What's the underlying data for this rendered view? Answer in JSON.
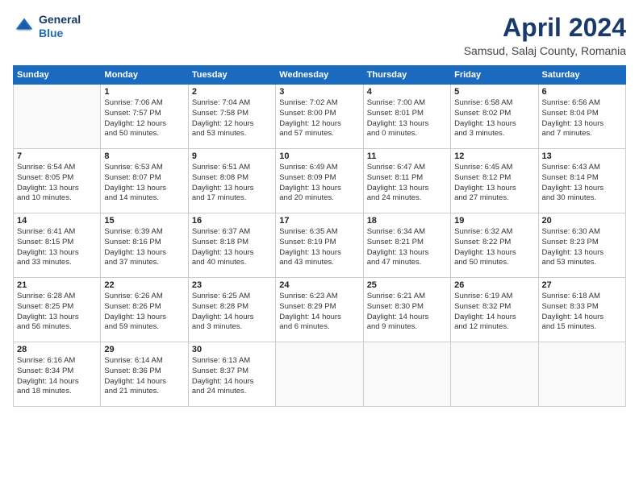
{
  "header": {
    "logo_line1": "General",
    "logo_line2": "Blue",
    "title": "April 2024",
    "subtitle": "Samsud, Salaj County, Romania"
  },
  "days_of_week": [
    "Sunday",
    "Monday",
    "Tuesday",
    "Wednesday",
    "Thursday",
    "Friday",
    "Saturday"
  ],
  "weeks": [
    [
      {
        "day": "",
        "info": ""
      },
      {
        "day": "1",
        "info": "Sunrise: 7:06 AM\nSunset: 7:57 PM\nDaylight: 12 hours\nand 50 minutes."
      },
      {
        "day": "2",
        "info": "Sunrise: 7:04 AM\nSunset: 7:58 PM\nDaylight: 12 hours\nand 53 minutes."
      },
      {
        "day": "3",
        "info": "Sunrise: 7:02 AM\nSunset: 8:00 PM\nDaylight: 12 hours\nand 57 minutes."
      },
      {
        "day": "4",
        "info": "Sunrise: 7:00 AM\nSunset: 8:01 PM\nDaylight: 13 hours\nand 0 minutes."
      },
      {
        "day": "5",
        "info": "Sunrise: 6:58 AM\nSunset: 8:02 PM\nDaylight: 13 hours\nand 3 minutes."
      },
      {
        "day": "6",
        "info": "Sunrise: 6:56 AM\nSunset: 8:04 PM\nDaylight: 13 hours\nand 7 minutes."
      }
    ],
    [
      {
        "day": "7",
        "info": "Sunrise: 6:54 AM\nSunset: 8:05 PM\nDaylight: 13 hours\nand 10 minutes."
      },
      {
        "day": "8",
        "info": "Sunrise: 6:53 AM\nSunset: 8:07 PM\nDaylight: 13 hours\nand 14 minutes."
      },
      {
        "day": "9",
        "info": "Sunrise: 6:51 AM\nSunset: 8:08 PM\nDaylight: 13 hours\nand 17 minutes."
      },
      {
        "day": "10",
        "info": "Sunrise: 6:49 AM\nSunset: 8:09 PM\nDaylight: 13 hours\nand 20 minutes."
      },
      {
        "day": "11",
        "info": "Sunrise: 6:47 AM\nSunset: 8:11 PM\nDaylight: 13 hours\nand 24 minutes."
      },
      {
        "day": "12",
        "info": "Sunrise: 6:45 AM\nSunset: 8:12 PM\nDaylight: 13 hours\nand 27 minutes."
      },
      {
        "day": "13",
        "info": "Sunrise: 6:43 AM\nSunset: 8:14 PM\nDaylight: 13 hours\nand 30 minutes."
      }
    ],
    [
      {
        "day": "14",
        "info": "Sunrise: 6:41 AM\nSunset: 8:15 PM\nDaylight: 13 hours\nand 33 minutes."
      },
      {
        "day": "15",
        "info": "Sunrise: 6:39 AM\nSunset: 8:16 PM\nDaylight: 13 hours\nand 37 minutes."
      },
      {
        "day": "16",
        "info": "Sunrise: 6:37 AM\nSunset: 8:18 PM\nDaylight: 13 hours\nand 40 minutes."
      },
      {
        "day": "17",
        "info": "Sunrise: 6:35 AM\nSunset: 8:19 PM\nDaylight: 13 hours\nand 43 minutes."
      },
      {
        "day": "18",
        "info": "Sunrise: 6:34 AM\nSunset: 8:21 PM\nDaylight: 13 hours\nand 47 minutes."
      },
      {
        "day": "19",
        "info": "Sunrise: 6:32 AM\nSunset: 8:22 PM\nDaylight: 13 hours\nand 50 minutes."
      },
      {
        "day": "20",
        "info": "Sunrise: 6:30 AM\nSunset: 8:23 PM\nDaylight: 13 hours\nand 53 minutes."
      }
    ],
    [
      {
        "day": "21",
        "info": "Sunrise: 6:28 AM\nSunset: 8:25 PM\nDaylight: 13 hours\nand 56 minutes."
      },
      {
        "day": "22",
        "info": "Sunrise: 6:26 AM\nSunset: 8:26 PM\nDaylight: 13 hours\nand 59 minutes."
      },
      {
        "day": "23",
        "info": "Sunrise: 6:25 AM\nSunset: 8:28 PM\nDaylight: 14 hours\nand 3 minutes."
      },
      {
        "day": "24",
        "info": "Sunrise: 6:23 AM\nSunset: 8:29 PM\nDaylight: 14 hours\nand 6 minutes."
      },
      {
        "day": "25",
        "info": "Sunrise: 6:21 AM\nSunset: 8:30 PM\nDaylight: 14 hours\nand 9 minutes."
      },
      {
        "day": "26",
        "info": "Sunrise: 6:19 AM\nSunset: 8:32 PM\nDaylight: 14 hours\nand 12 minutes."
      },
      {
        "day": "27",
        "info": "Sunrise: 6:18 AM\nSunset: 8:33 PM\nDaylight: 14 hours\nand 15 minutes."
      }
    ],
    [
      {
        "day": "28",
        "info": "Sunrise: 6:16 AM\nSunset: 8:34 PM\nDaylight: 14 hours\nand 18 minutes."
      },
      {
        "day": "29",
        "info": "Sunrise: 6:14 AM\nSunset: 8:36 PM\nDaylight: 14 hours\nand 21 minutes."
      },
      {
        "day": "30",
        "info": "Sunrise: 6:13 AM\nSunset: 8:37 PM\nDaylight: 14 hours\nand 24 minutes."
      },
      {
        "day": "",
        "info": ""
      },
      {
        "day": "",
        "info": ""
      },
      {
        "day": "",
        "info": ""
      },
      {
        "day": "",
        "info": ""
      }
    ]
  ]
}
